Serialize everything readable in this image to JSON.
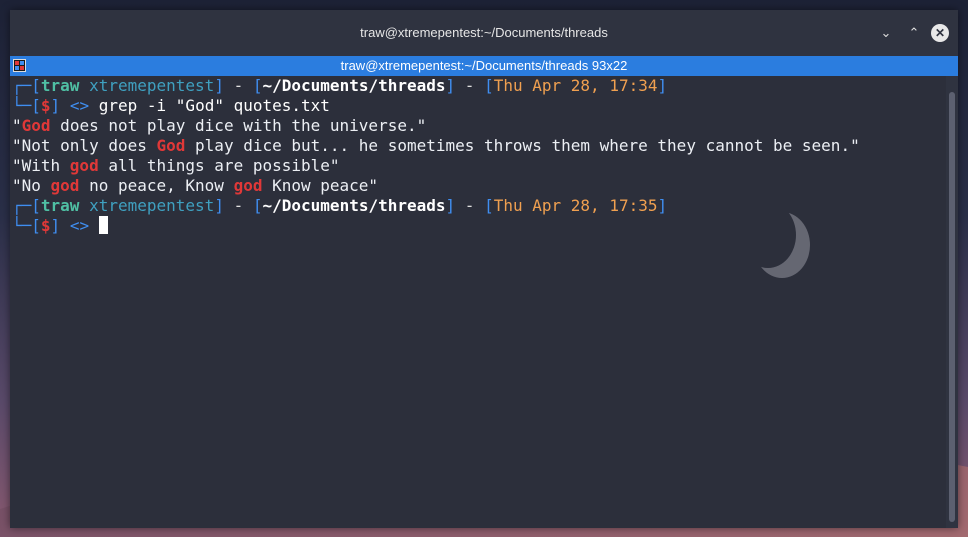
{
  "window": {
    "title": "traw@xtremepentest:~/Documents/threads",
    "tab_title": "traw@xtremepentest:~/Documents/threads 93x22",
    "min_glyph": "⌄",
    "max_glyph": "⌃",
    "close_glyph": "✕"
  },
  "prompt1": {
    "user": "traw",
    "host": "xtremepentest",
    "dir": "~/Documents/threads",
    "date": "Thu Apr 28, 17:34",
    "symbol": "$",
    "arrows": "<>",
    "command": "grep -i \"God\" quotes.txt"
  },
  "output": [
    {
      "pre": "\"",
      "match": "God",
      "post": " does not play dice with the universe.\""
    },
    {
      "pre": "\"Not only does ",
      "match": "God",
      "post": " play dice but... he sometimes throws them where they cannot be seen.\""
    },
    {
      "pre": "\"With ",
      "match": "god",
      "post": " all things are possible\""
    },
    {
      "pre": "\"No ",
      "match": "god",
      "post": " no peace, Know ",
      "match2": "god",
      "post2": " Know peace\""
    }
  ],
  "prompt2": {
    "user": "traw",
    "host": "xtremepentest",
    "dir": "~/Documents/threads",
    "date": "Thu Apr 28, 17:35",
    "symbol": "$",
    "arrows": "<>"
  },
  "colors": {
    "accent": "#2b7ddf",
    "match": "#e03838",
    "date": "#f0a050",
    "user": "#4fc0a4"
  }
}
